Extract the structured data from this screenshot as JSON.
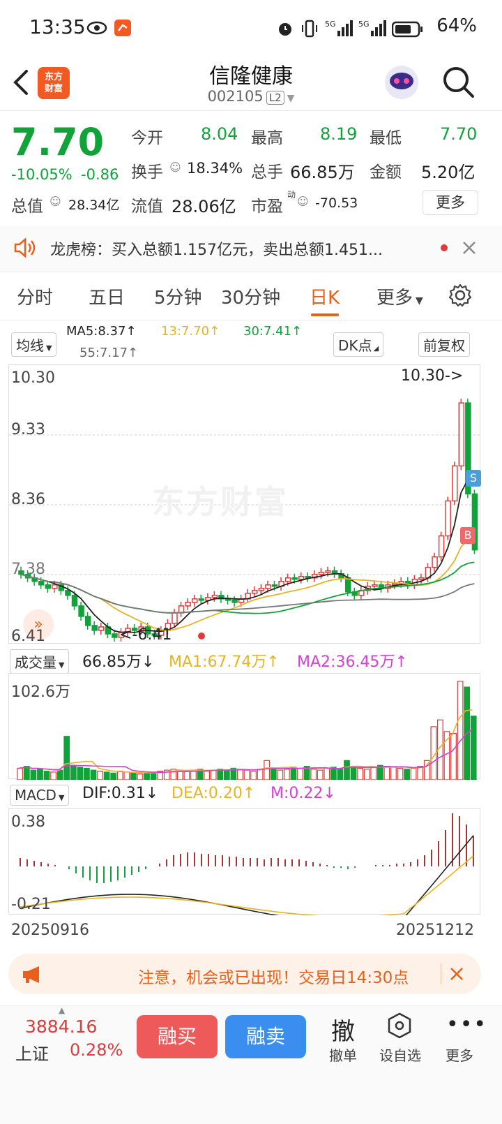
{
  "status": {
    "time": "13:35",
    "battery": "64%"
  },
  "header": {
    "name": "信隆健康",
    "code": "002105",
    "level_badge": "L2",
    "logo_text": "东方\n财富"
  },
  "quote": {
    "price": "7.70",
    "pct": "-10.05%",
    "change": "-0.86",
    "open_label": "今开",
    "open": "8.04",
    "high_label": "最高",
    "high": "8.19",
    "low_label": "最低",
    "low": "7.70",
    "turnover_label": "换手",
    "turnover": "18.34%",
    "volume_label": "总手",
    "volume": "66.85万",
    "amount_label": "金额",
    "amount": "5.20亿",
    "mcap_label": "总值",
    "mcap": "28.34亿",
    "float_label": "流值",
    "float": "28.06亿",
    "pe_label": "市盈",
    "pe_sup": "动",
    "pe": "-70.53",
    "more": "更多"
  },
  "notice": {
    "text": "龙虎榜：买入总额1.157亿元，卖出总额1.451..."
  },
  "tabs": [
    "分时",
    "五日",
    "5分钟",
    "30分钟",
    "日K",
    "更多"
  ],
  "active_tab": "日K",
  "kline": {
    "ma_btn": "均线",
    "dk_btn": "DK点",
    "adj_btn": "前复权",
    "ma5": "MA5:8.37↑",
    "ma13": "13:7.70↑",
    "ma30": "30:7.41↑",
    "ma55": "55:7.17↑",
    "y_labels": [
      "10.30",
      "9.33",
      "8.36",
      "7.38",
      "6.41"
    ],
    "max_marker": "10.30->",
    "min_marker": "<-6.41",
    "watermark": "东方财富",
    "markers": {
      "s": "S",
      "b": "B"
    }
  },
  "volume": {
    "btn": "成交量",
    "value": "66.85万↓",
    "ma1": "MA1:67.74万↑",
    "ma2": "MA2:36.45万↑",
    "y_label": "102.6万"
  },
  "macd": {
    "btn": "MACD",
    "dif": "DIF:0.31↓",
    "dea": "DEA:0.20↑",
    "m": "M:0.22↓",
    "y_top": "0.38",
    "y_bottom": "-0.21"
  },
  "dates": {
    "start": "20250916",
    "end": "20251212"
  },
  "alert": {
    "text": "注意，机会或已出现！交易日14:30点"
  },
  "bottom": {
    "index_value": "3884.16",
    "index_name": "上证",
    "index_pct": "0.28%",
    "buy": "融买",
    "sell": "融卖",
    "cancel_glyph": "撤",
    "cancel_label": "撤单",
    "watch_label": "设自选",
    "more_label": "更多"
  },
  "colors": {
    "up": "#e03b3b",
    "down": "#11a33a",
    "accent": "#e8601b",
    "ma5": "#222222",
    "ma13": "#e6b422",
    "ma30": "#11a33a",
    "ma55": "#777777",
    "ma2": "#d43fd4"
  }
}
